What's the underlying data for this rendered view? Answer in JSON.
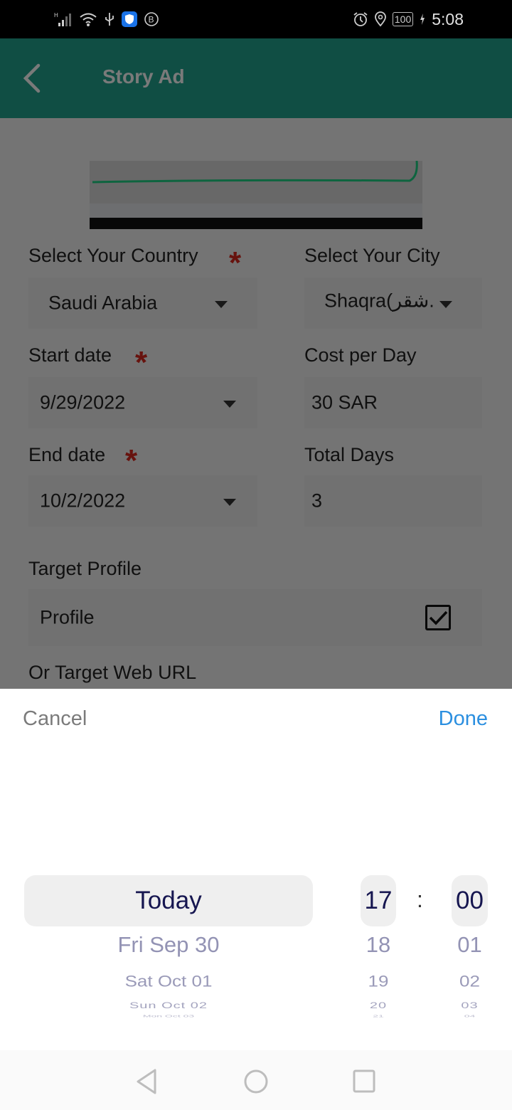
{
  "status_bar": {
    "left_icons": [
      "signal-h-icon",
      "wifi-icon",
      "usb-icon",
      "shield-app-icon",
      "b-badge-icon"
    ],
    "right_icons": [
      "alarm-icon",
      "location-icon"
    ],
    "battery": "100",
    "time": "5:08"
  },
  "app_bar": {
    "title": "Story Ad",
    "color": "#22a48f"
  },
  "form": {
    "country": {
      "label": "Select Your Country",
      "required": true,
      "value": "Saudi Arabia"
    },
    "city": {
      "label": "Select Your City",
      "required": false,
      "value": "Shaqra(شقر."
    },
    "start_date": {
      "label": "Start date",
      "required": true,
      "value": "9/29/2022"
    },
    "cost_per_day": {
      "label": "Cost per Day",
      "value": "30 SAR"
    },
    "end_date": {
      "label": "End date",
      "required": true,
      "value": "10/2/2022"
    },
    "total_days": {
      "label": "Total Days",
      "value": "3"
    },
    "target_profile": {
      "label": "Target Profile",
      "option": "Profile",
      "checked": true
    },
    "target_url": {
      "label": "Or Target Web URL"
    },
    "required_marker": "*"
  },
  "picker": {
    "cancel_label": "Cancel",
    "done_label": "Done",
    "date_wheel": [
      "Today",
      "Fri Sep 30",
      "Sat Oct 01",
      "Sun Oct 02",
      "Mon Oct 03"
    ],
    "hour_wheel": [
      "17",
      "18",
      "19",
      "20",
      "21"
    ],
    "minute_wheel": [
      "00",
      "01",
      "02",
      "03",
      "04"
    ],
    "separator": ":",
    "accent_color": "#2b8fe0"
  },
  "nav_bar": {
    "buttons": [
      "back",
      "home",
      "recents"
    ]
  }
}
